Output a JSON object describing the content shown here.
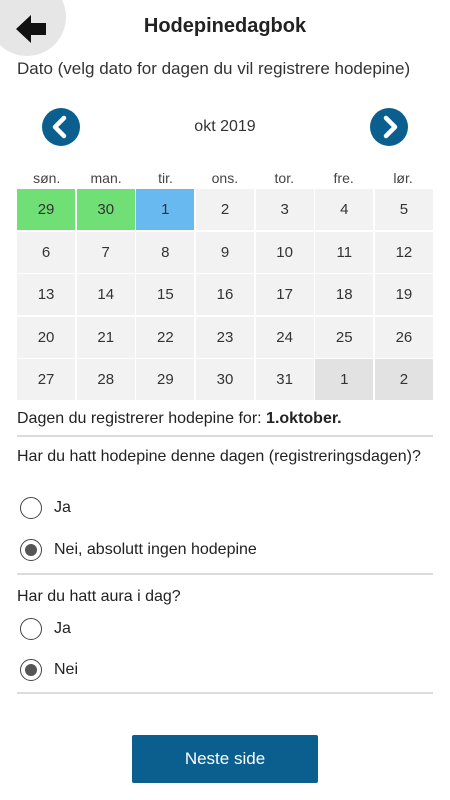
{
  "header": {
    "title": "Hodepinedagbok",
    "back_icon": "arrow-left-icon"
  },
  "intro_text": "Dato (velg dato for dagen du vil registrere hodepine)",
  "calendar": {
    "month_label": "okt 2019",
    "prev_icon": "chevron-left-icon",
    "next_icon": "chevron-right-icon",
    "weekdays": [
      "søn.",
      "man.",
      "tir.",
      "ons.",
      "tor.",
      "fre.",
      "lør."
    ],
    "days": [
      {
        "label": "29",
        "state": "green"
      },
      {
        "label": "30",
        "state": "green"
      },
      {
        "label": "1",
        "state": "blue"
      },
      {
        "label": "2",
        "state": "normal"
      },
      {
        "label": "3",
        "state": "normal"
      },
      {
        "label": "4",
        "state": "normal"
      },
      {
        "label": "5",
        "state": "normal"
      },
      {
        "label": "6",
        "state": "normal"
      },
      {
        "label": "7",
        "state": "normal"
      },
      {
        "label": "8",
        "state": "normal"
      },
      {
        "label": "9",
        "state": "normal"
      },
      {
        "label": "10",
        "state": "normal"
      },
      {
        "label": "11",
        "state": "normal"
      },
      {
        "label": "12",
        "state": "normal"
      },
      {
        "label": "13",
        "state": "normal"
      },
      {
        "label": "14",
        "state": "normal"
      },
      {
        "label": "15",
        "state": "normal"
      },
      {
        "label": "16",
        "state": "normal"
      },
      {
        "label": "17",
        "state": "normal"
      },
      {
        "label": "18",
        "state": "normal"
      },
      {
        "label": "19",
        "state": "normal"
      },
      {
        "label": "20",
        "state": "normal"
      },
      {
        "label": "21",
        "state": "normal"
      },
      {
        "label": "22",
        "state": "normal"
      },
      {
        "label": "23",
        "state": "normal"
      },
      {
        "label": "24",
        "state": "normal"
      },
      {
        "label": "25",
        "state": "normal"
      },
      {
        "label": "26",
        "state": "normal"
      },
      {
        "label": "27",
        "state": "normal"
      },
      {
        "label": "28",
        "state": "normal"
      },
      {
        "label": "29",
        "state": "normal"
      },
      {
        "label": "30",
        "state": "normal"
      },
      {
        "label": "31",
        "state": "normal"
      },
      {
        "label": "1",
        "state": "other"
      },
      {
        "label": "2",
        "state": "other"
      }
    ],
    "colors": {
      "green": "#6fdf76",
      "blue": "#68b9f0",
      "normal": "#f2f2f2",
      "other": "#e2e2e2"
    }
  },
  "selected": {
    "prefix": "Dagen du registrerer hodepine for: ",
    "date": "1.oktober."
  },
  "question1": {
    "text": "Har du hatt hodepine denne dagen (registreringsdagen)?",
    "options": [
      {
        "label": "Ja",
        "checked": false
      },
      {
        "label": "Nei, absolutt ingen hodepine",
        "checked": true
      }
    ]
  },
  "question2": {
    "text": "Har du hatt aura i dag?",
    "options": [
      {
        "label": "Ja",
        "checked": false
      },
      {
        "label": "Nei",
        "checked": true
      }
    ]
  },
  "next_button": {
    "label": "Neste side",
    "color": "#0a5f8f"
  }
}
